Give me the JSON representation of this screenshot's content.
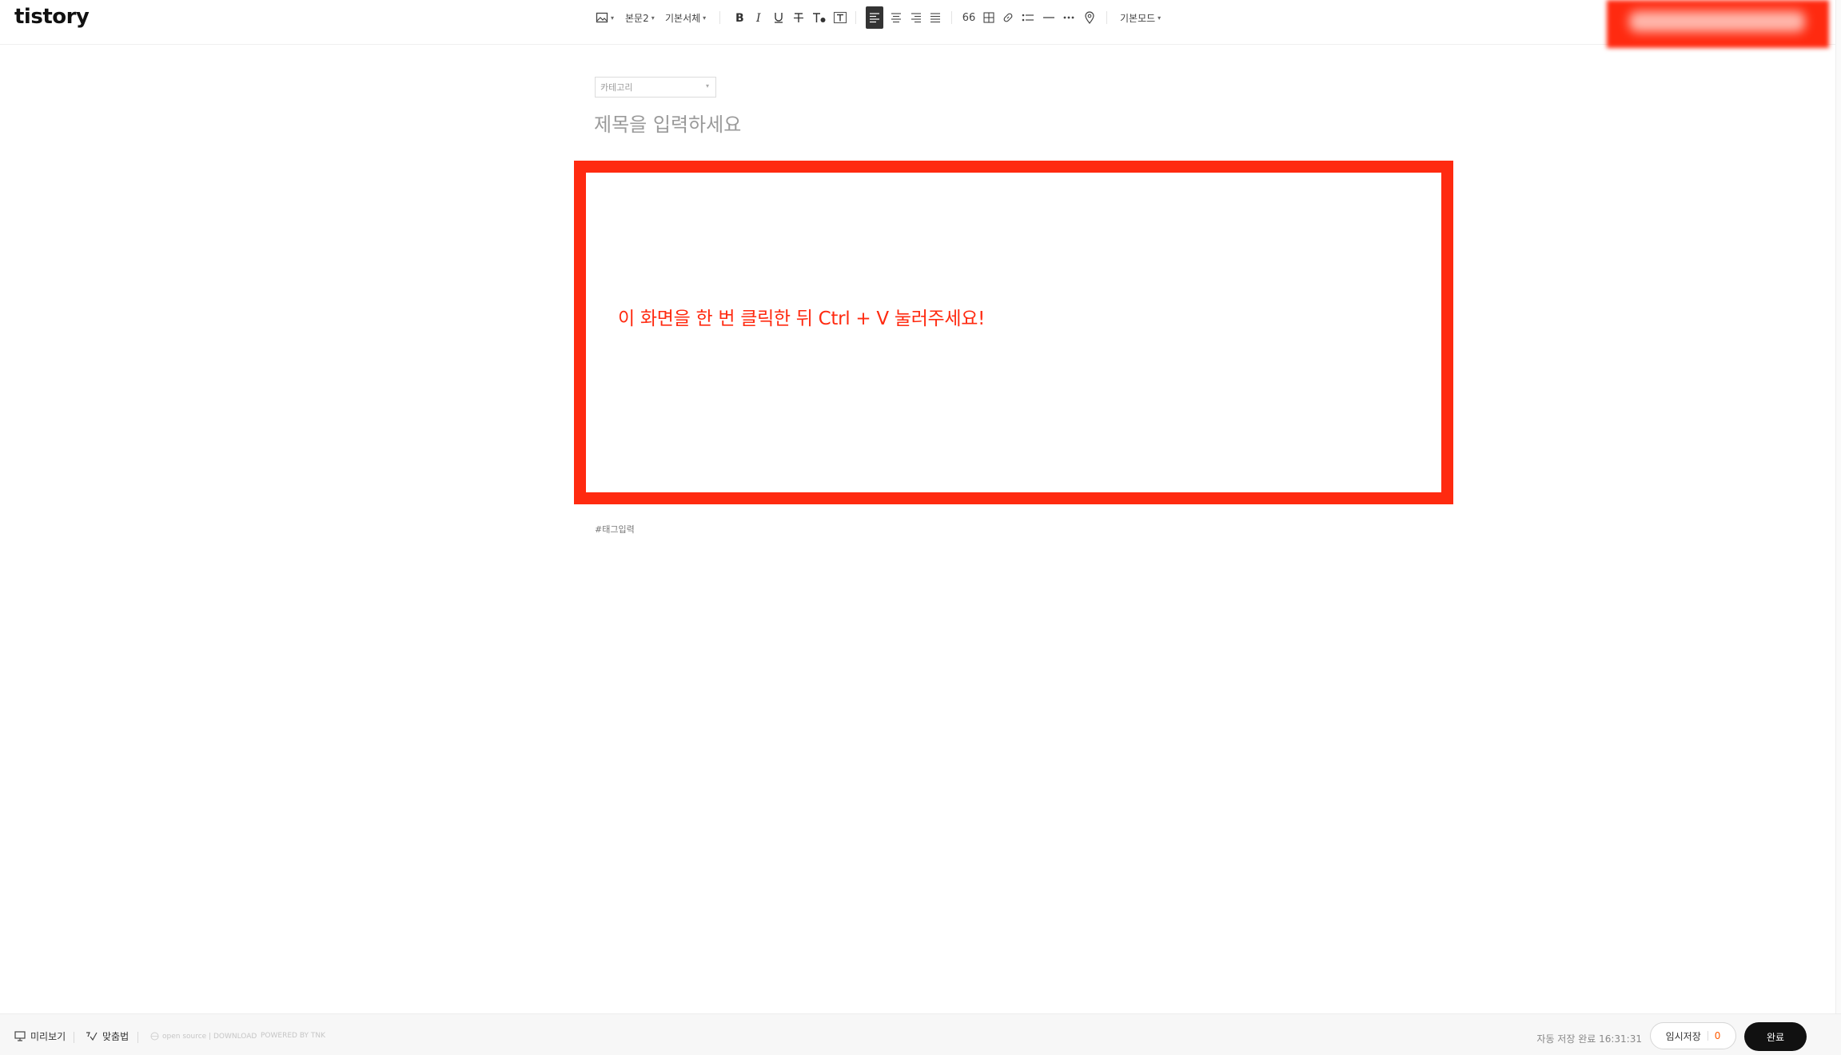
{
  "app": {
    "logo": "tistory"
  },
  "toolbar": {
    "paragraph_style": "본문2",
    "font_family": "기본서체",
    "mode": "기본모드",
    "quote_icon_text": "66"
  },
  "editor": {
    "category_placeholder": "카테고리",
    "title_placeholder": "제목을 입력하세요",
    "paste_message": "이 화면을 한 번 클릭한 뒤 Ctrl + V 눌러주세요!",
    "tag_placeholder": "#태그입력"
  },
  "footer": {
    "preview_label": "미리보기",
    "spellcheck_label": "맞춤법",
    "opensource_label": "open source | DOWNLOAD",
    "powered_label": "POWERED BY TNK",
    "autosave_text": "자동 저장 완료 16:31:31",
    "draft_label": "임시저장",
    "draft_count": "0",
    "done_label": "완료"
  },
  "colors": {
    "highlight": "#ff2a10",
    "draft_count": "#ff5a00",
    "done_bg": "#111111"
  }
}
